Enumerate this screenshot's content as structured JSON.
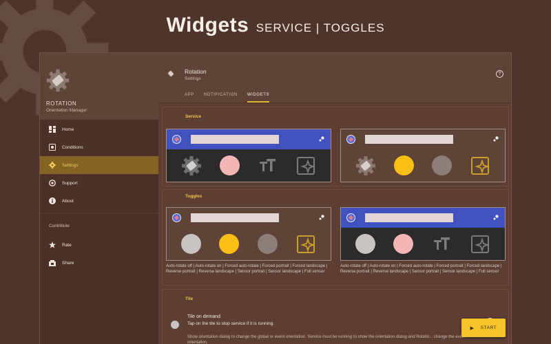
{
  "banner": {
    "title": "Widgets",
    "subtitle": "SERVICE | TOGGLES"
  },
  "sidebar": {
    "app_title": "ROTATION",
    "app_subtitle": "Orientation Manager",
    "items": [
      {
        "label": "Home",
        "icon": "dashboard-icon"
      },
      {
        "label": "Conditions",
        "icon": "conditions-icon"
      },
      {
        "label": "Settings",
        "icon": "gear-icon",
        "active": true
      },
      {
        "label": "Support",
        "icon": "support-icon"
      },
      {
        "label": "About",
        "icon": "info-icon"
      }
    ],
    "section_contribute": "Contribute",
    "contribute_items": [
      {
        "label": "Rate",
        "icon": "star-icon"
      },
      {
        "label": "Share",
        "icon": "share-icon"
      }
    ]
  },
  "topbar": {
    "title": "Rotation",
    "subtitle": "Settings",
    "help_icon": "?",
    "tabs": [
      {
        "label": "APP"
      },
      {
        "label": "NOTIFICATION"
      },
      {
        "label": "WIDGETS",
        "active": true
      }
    ]
  },
  "service": {
    "title": "Service"
  },
  "toggles": {
    "title": "Toggles",
    "caption_left": "Auto-rotate off | Auto-rotate on | Forced auto-rotate | Forced portrait | Forced landscape | Reverse portrait | Reverse landscape | Sensor portrait | Sensor landscape | Full sensor",
    "caption_right": "Auto-rotate off | Auto-rotate on | Forced auto-rotate | Forced portrait | Forced landscape | Reverse portrait | Reverse landscape | Sensor portrait | Sensor landscape | Full sensor"
  },
  "tile": {
    "title": "Tile",
    "name": "Tile on demand",
    "help": "Tap on the tile to stop service if it is running.",
    "description": "Show orientation dialog to change the global or event orientation. Service must be running to show the orientation dialog and Rotatio... change the event orientation."
  },
  "fab": {
    "label": "START"
  },
  "colors": {
    "background": "#4f3429",
    "accent": "#f2c24a",
    "widget_blue": "#4151c0",
    "fab": "#f6c42a"
  }
}
